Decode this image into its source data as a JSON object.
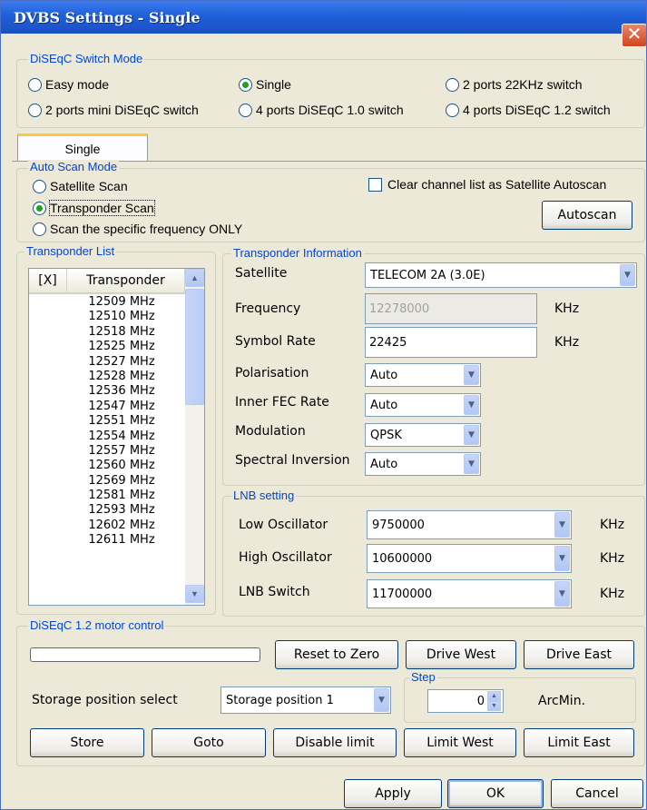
{
  "window": {
    "title": "DVBS Settings - Single",
    "close": "✕"
  },
  "diseqc_mode": {
    "legend": "DiSEqC Switch Mode",
    "options": [
      "Easy mode",
      "Single",
      "2 ports 22KHz switch",
      "2 ports mini DiSEqC switch",
      "4 ports DiSEqC 1.0 switch",
      "4 ports DiSEqC 1.2 switch"
    ],
    "selected": "Single"
  },
  "tab": {
    "label": "Single"
  },
  "auto_scan": {
    "legend": "Auto Scan Mode",
    "options": [
      "Satellite Scan",
      "Transponder Scan",
      "Scan the specific frequency ONLY"
    ],
    "selected": "Transponder Scan",
    "clear_label": "Clear channel list as Satellite Autoscan",
    "autoscan_button": "Autoscan"
  },
  "transponder_list": {
    "legend": "Transponder List",
    "headers": [
      "[X]",
      "Transponder"
    ],
    "rows": [
      "12509 MHz",
      "12510 MHz",
      "12518 MHz",
      "12525 MHz",
      "12527 MHz",
      "12528 MHz",
      "12536 MHz",
      "12547 MHz",
      "12551 MHz",
      "12554 MHz",
      "12557 MHz",
      "12560 MHz",
      "12569 MHz",
      "12581 MHz",
      "12593 MHz",
      "12602 MHz",
      "12611 MHz"
    ]
  },
  "transponder_info": {
    "legend": "Transponder Information",
    "satellite_label": "Satellite",
    "satellite_value": "TELECOM 2A (3.0E)",
    "frequency_label": "Frequency",
    "frequency_value": "12278000",
    "frequency_unit": "KHz",
    "symbol_label": "Symbol Rate",
    "symbol_value": "22425",
    "symbol_unit": "KHz",
    "polarisation_label": "Polarisation",
    "polarisation_value": "Auto",
    "fec_label": "Inner FEC Rate",
    "fec_value": "Auto",
    "modulation_label": "Modulation",
    "modulation_value": "QPSK",
    "inversion_label": "Spectral Inversion",
    "inversion_value": "Auto"
  },
  "lnb": {
    "legend": "LNB setting",
    "low_label": "Low Oscillator",
    "low_value": "9750000",
    "high_label": "High Oscillator",
    "high_value": "10600000",
    "switch_label": "LNB Switch",
    "switch_value": "11700000",
    "unit": "KHz"
  },
  "motor": {
    "legend": "DiSEqC 1.2 motor control",
    "reset": "Reset to Zero",
    "drive_west": "Drive West",
    "drive_east": "Drive East",
    "storage_label": "Storage position select",
    "storage_value": "Storage position  1",
    "step_legend": "Step",
    "step_value": "0",
    "step_unit": "ArcMin.",
    "store": "Store",
    "goto": "Goto",
    "disable_limit": "Disable limit",
    "limit_west": "Limit West",
    "limit_east": "Limit East"
  },
  "footer": {
    "apply": "Apply",
    "ok": "OK",
    "cancel": "Cancel"
  }
}
